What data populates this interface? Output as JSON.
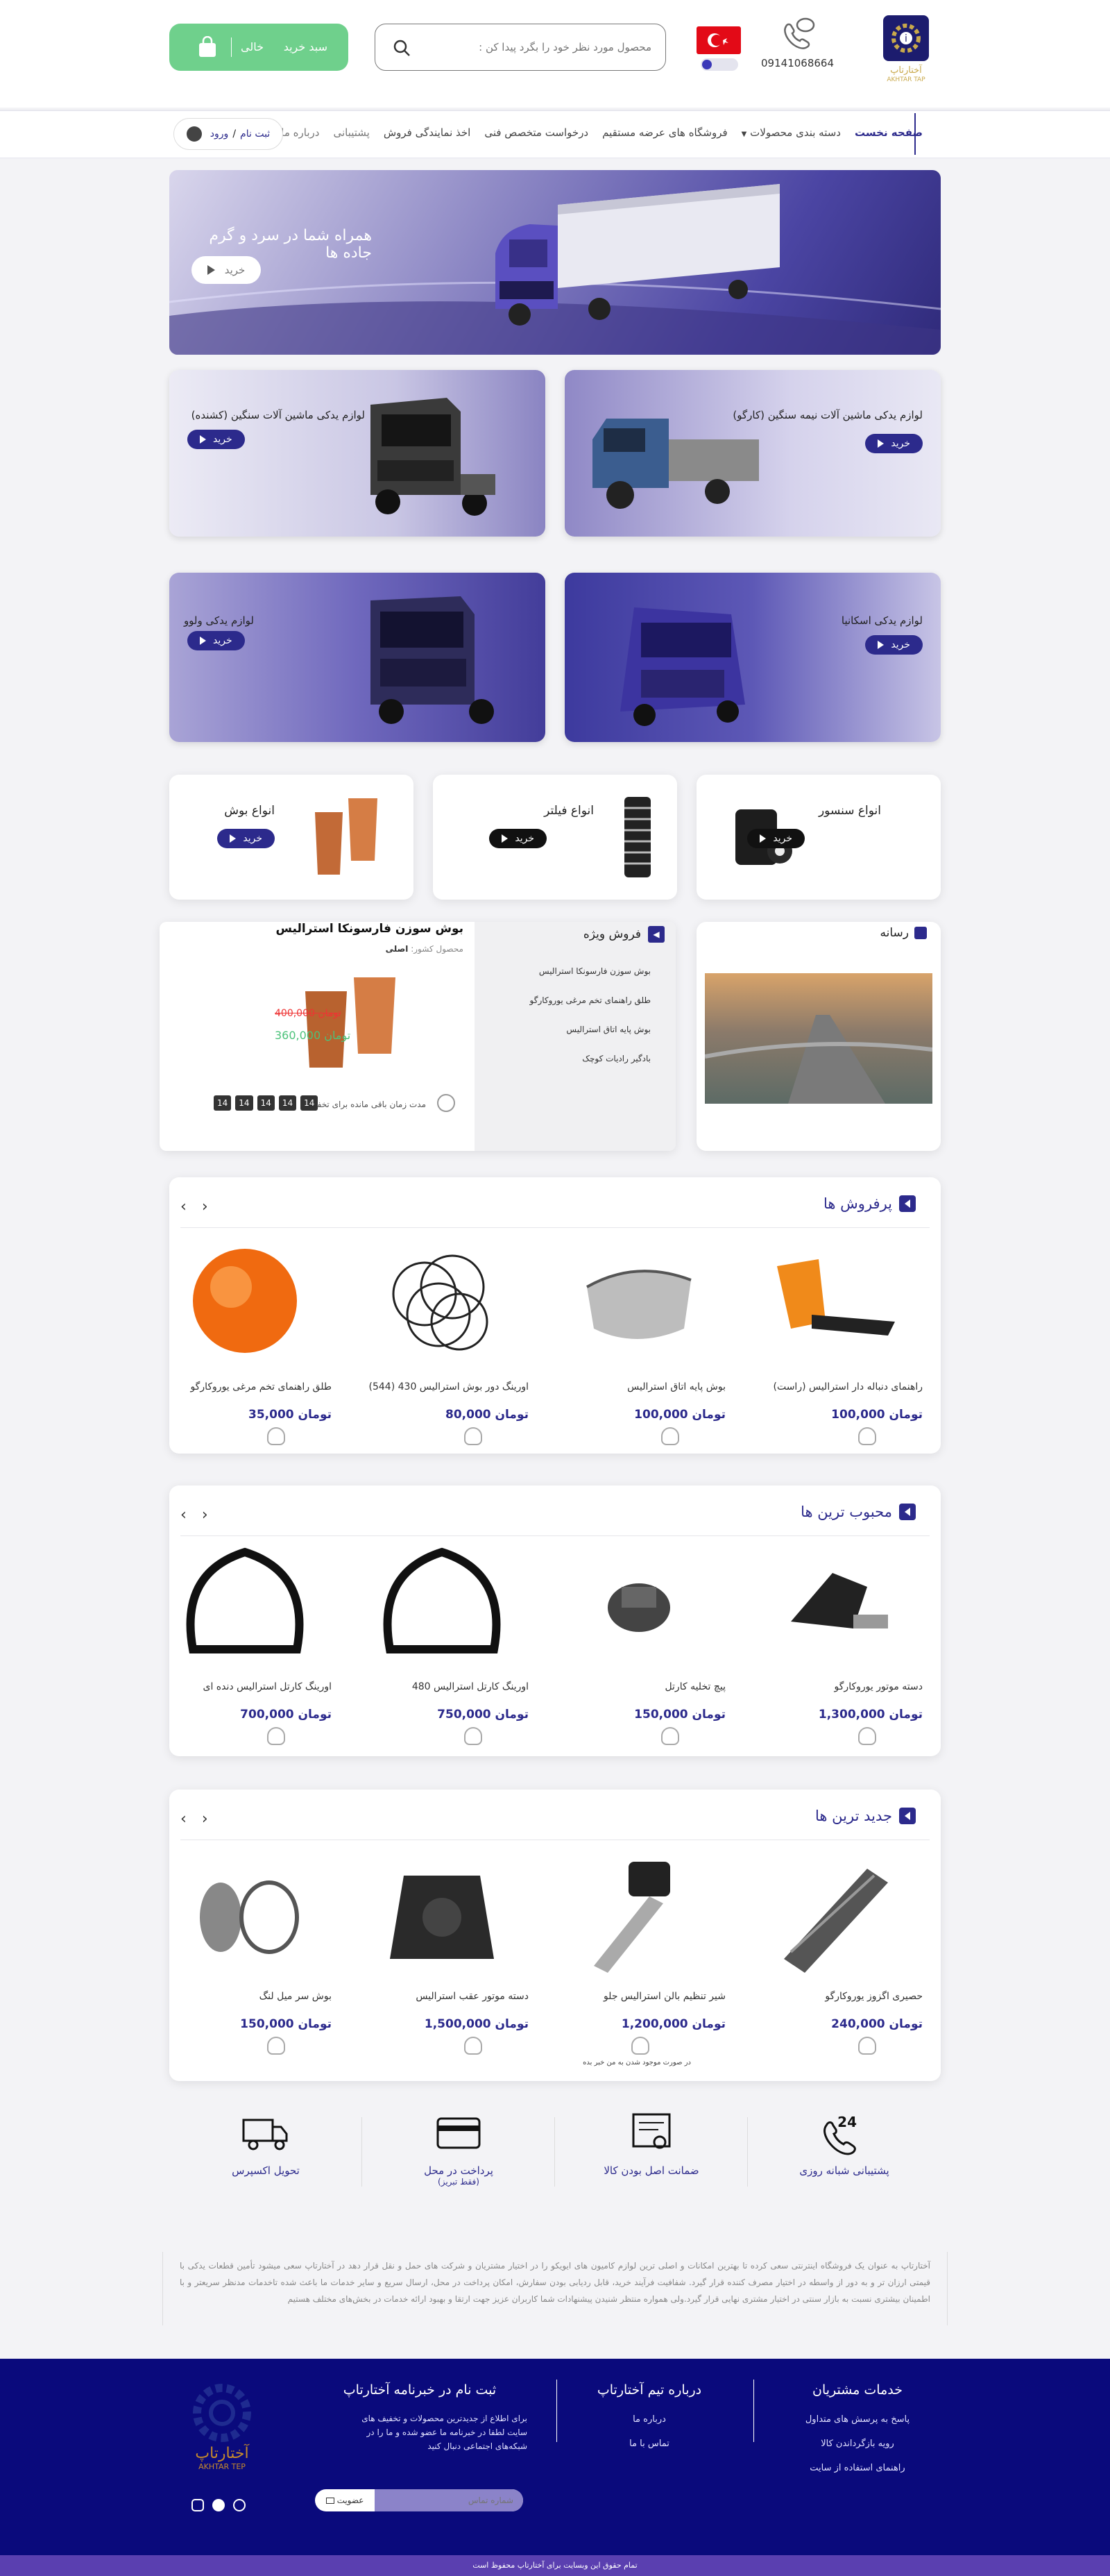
{
  "header": {
    "phone": "09141068664",
    "search_placeholder": "محصول مورد نظر خود را بگرد پیدا کن :",
    "cart_label": "سبد خرید",
    "cart_status": "خالی",
    "logo_text": "آختارتاپ",
    "logo_subtext": "AKHTAR TAP"
  },
  "nav": {
    "items": [
      "صفحه نخست",
      "دسته بندی محصولات",
      "فروشگاه های عرضه مستقیم",
      "درخواست متخصص فنی",
      "اخذ نمایندگی فروش",
      "پشتیبانی",
      "درباره ما"
    ],
    "login": "ورود",
    "register": "ثبت نام",
    "separator": "/"
  },
  "hero": {
    "slogan": "همراه شما در سرد و گرم جاده ها",
    "button": "خرید"
  },
  "promos": [
    {
      "title": "لوازم یدکی ماشین آلات نیمه سنگین (کارگو)",
      "button": "خرید"
    },
    {
      "title": "لوازم یدکی ماشین آلات سنگین (کشنده)",
      "button": "خرید"
    },
    {
      "title": "لوازم یدکی اسکانیا",
      "button": "خرید"
    },
    {
      "title": "لوازم یدکی ولوو",
      "button": "خرید"
    }
  ],
  "categories": [
    {
      "title": "انواع سنسور",
      "button": "خرید"
    },
    {
      "title": "انواع فیلتر",
      "button": "خرید"
    },
    {
      "title": "انواع بوش",
      "button": "خرید"
    }
  ],
  "media": {
    "title": "رسانه"
  },
  "special": {
    "title": "فروش ویژه",
    "list": [
      "بوش سوزن فارسونکا استرالیس",
      "طلق راهنمای تخم مرغی یوروکارگو",
      "بوش پایه اتاق استرالیس",
      "بادگیر رادیات کوچک"
    ],
    "product_name": "بوش سوزن فارسونکا استرالیس",
    "country_label": "محصول کشور:",
    "country_value": "اصلی",
    "old_price": "400,000",
    "new_price": "360,000",
    "currency": "تومان",
    "timer_label": "مدت زمان باقی مانده برای تخفیف:",
    "timer": [
      "14",
      "14",
      "14",
      "14",
      "14"
    ]
  },
  "sections": [
    {
      "title": "پرفروش ها",
      "products": [
        {
          "name": "راهنمای دنباله دار استرالیس (راست)",
          "price": "100,000"
        },
        {
          "name": "بوش پایه اتاق استرالیس",
          "price": "100,000"
        },
        {
          "name": "اورینگ دور بوش استرالیس 430 (544)",
          "price": "80,000"
        },
        {
          "name": "طلق راهنمای تخم مرغی یوروکارگو",
          "price": "35,000"
        }
      ]
    },
    {
      "title": "محبوب ترین ها",
      "products": [
        {
          "name": "دسته موتور یوروکارگو",
          "price": "1,300,000"
        },
        {
          "name": "پیچ تخلیه کارتل",
          "price": "150,000"
        },
        {
          "name": "اورینگ کارتل استرالیس 480",
          "price": "750,000"
        },
        {
          "name": "اورینگ کارتل استرالیس دنده ای",
          "price": "700,000"
        }
      ]
    },
    {
      "title": "جدید ترین ها",
      "products": [
        {
          "name": "حصیری اگزوز یوروکارگو",
          "price": "240,000"
        },
        {
          "name": "شیر تنظیم بالن استرالیس جلو",
          "price": "1,200,000"
        },
        {
          "name": "دسته موتور عقب استرالیس",
          "price": "1,500,000"
        },
        {
          "name": "بوش سر میل لنگ",
          "price": "150,000"
        }
      ],
      "notify_note": "در صورت موجود شدن به من خبر بده"
    }
  ],
  "currency": "تومان",
  "features": [
    {
      "title": "پشتیبانی شبانه روزی",
      "icon": "phone-24-icon"
    },
    {
      "title": "ضمانت اصل بودن کالا",
      "icon": "certificate-icon"
    },
    {
      "title": "پرداخت در محل",
      "subtitle": "(فقط تبریز)",
      "icon": "card-icon"
    },
    {
      "title": "تحویل اکسپرس",
      "icon": "truck-icon"
    }
  ],
  "about_text": "آختارتاپ به عنوان یک فروشگاه اینترنتی سعی کرده تا بهترین امکانات و اصلی ترین لوازم کامیون های ایویکو را در اختیار مشتریان و شرکت های حمل و نقل قرار دهد در آختارتاپ سعی میشود تأمین قطعات یدکی با قیمتی ارزان تر و به دور از واسطه در اختیار مصرف کننده قرار گیرد. شفافیت فرآیند خرید، قابل ردیابی بودن سفارش، امکان پرداخت در محل، ارسال سریع و سایر خدمات ما باعث شده تاخدمات مدنظر سریعتر و با اطمینان بیشتری نسبت به بازار سنتی در اختیار مشتری نهایی قرار گیرد.ولی همواره منتظر شنیدن پیشنهادات شما کاربران عزیز جهت ارتقا و بهبود ارائه خدمات در بخش‌های مختلف هستیم",
  "footer": {
    "col1_title": "خدمات مشتریان",
    "col1_links": [
      "پاسخ به پرسش های متداول",
      "رویه بازگرداندن کالا",
      "راهنمای استفاده از سایت"
    ],
    "col2_title": "درباره تیم آختارتاپ",
    "col2_links": [
      "درباره ما",
      "تماس با ما"
    ],
    "col3_title": "ثبت نام در خبرنامه آختارتاپ",
    "col3_text": "برای اطلاع از جدیدترین محصولات و تخفیف های سایت لطفا در خبرنامه ما عضو شده و ما را در شبکه‌های اجتماعی دنبال کنید",
    "newsletter_placeholder": "شماره تماس",
    "newsletter_button": "عضویت",
    "logo_text": "آختارتاپ",
    "logo_subtext": "AKHTAR TEP",
    "copyright": "تمام حقوق این وبسایت برای آختارتاپ محفوظ است"
  },
  "colors": {
    "primary": "#2c2a8c",
    "green": "#6fd08c",
    "footer": "#0a0a7c",
    "bottom_bar": "#5a3fb0"
  }
}
